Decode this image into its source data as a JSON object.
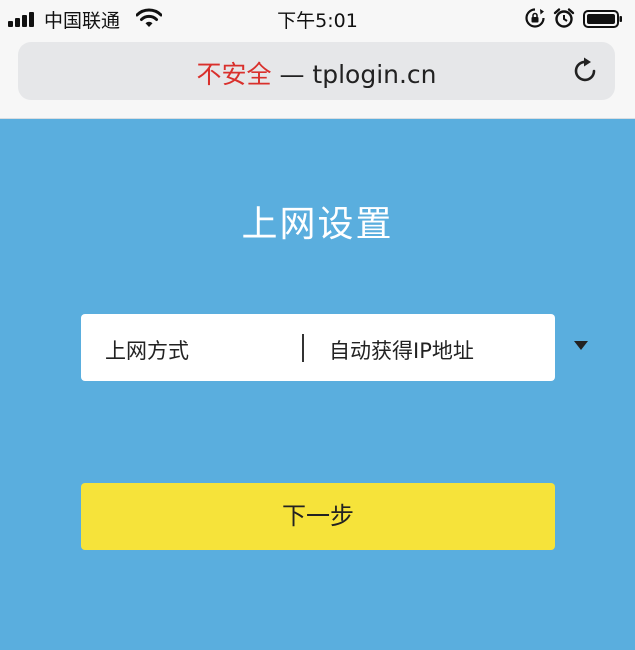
{
  "status_bar": {
    "carrier": "中国联通",
    "time": "下午5:01",
    "icons": [
      "signal-icon",
      "wifi-icon",
      "rotation-lock-icon",
      "alarm-icon",
      "battery-icon"
    ]
  },
  "browser": {
    "security_label": "不安全",
    "separator": " — ",
    "url": "tplogin.cn",
    "reload_icon": "reload-icon"
  },
  "page": {
    "title": "上网设置",
    "connection_field": {
      "label": "上网方式",
      "selected": "自动获得IP地址",
      "arrow_icon": "triangle-down-icon"
    },
    "next_button_label": "下一步"
  },
  "colors": {
    "background": "#5aaede",
    "button": "#f6e33a",
    "insecure_text": "#d9302c"
  }
}
